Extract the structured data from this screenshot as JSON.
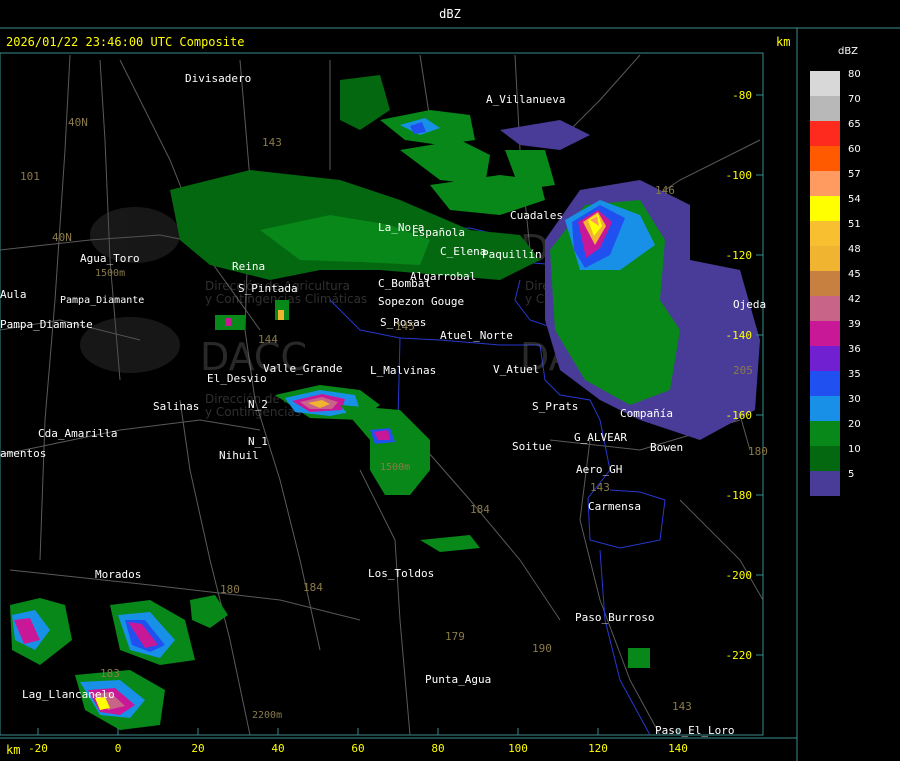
{
  "header": {
    "title": "dBZ"
  },
  "timestamp": "2026/01/22 23:46:00 UTC Composite",
  "unit_top": "km",
  "unit_bottom": "km",
  "axes": {
    "x_ticks": [
      "-20",
      "0",
      "20",
      "40",
      "60",
      "80",
      "100",
      "120",
      "140"
    ],
    "y_ticks": [
      "-80",
      "-100",
      "-120",
      "-140",
      "-160",
      "-180",
      "-200",
      "-220"
    ]
  },
  "legend": {
    "title": "dBZ",
    "entries": [
      {
        "label": "80",
        "color": "#d8d8d8"
      },
      {
        "label": "70",
        "color": "#b8b8b8"
      },
      {
        "label": "65",
        "color": "#ff2a1e"
      },
      {
        "label": "60",
        "color": "#ff5a00"
      },
      {
        "label": "57",
        "color": "#ff9a60"
      },
      {
        "label": "54",
        "color": "#ffff00"
      },
      {
        "label": "51",
        "color": "#f8c030"
      },
      {
        "label": "48",
        "color": "#f0b430"
      },
      {
        "label": "45",
        "color": "#c88040"
      },
      {
        "label": "42",
        "color": "#c86488"
      },
      {
        "label": "39",
        "color": "#c81898"
      },
      {
        "label": "36",
        "color": "#7020d0"
      },
      {
        "label": "35",
        "color": "#2050f0"
      },
      {
        "label": "30",
        "color": "#1890e8"
      },
      {
        "label": "20",
        "color": "#088818"
      },
      {
        "label": "10",
        "color": "#046810"
      },
      {
        "label": "5",
        "color": "#483c98"
      }
    ]
  },
  "places": [
    "Divisadero",
    "A_Villanueva",
    "Cuadales",
    "Agua_Toro",
    "Aula",
    "Pampa_Diamante",
    "Pampa_Diamante",
    "La_Nora",
    "Española",
    "C_Elena",
    "Paquillín",
    "Algarrobal",
    "C_Bombal",
    "Sopezon Gouge",
    "S_Rosas",
    "Atuel_Norte",
    "S_Pintada",
    "Reina",
    "L_Malvinas",
    "V_Atuel",
    "El_Desvio",
    "Valle_Grande",
    "Salinas",
    "N_2",
    "N_1",
    "Nihuil",
    "Cda_Amarilla",
    "amentos",
    "S_Prats",
    "Soitue",
    "G_ALVEAR",
    "Compañía",
    "Bowen",
    "Aero_GH",
    "Carmensa",
    "Morados",
    "Los_Toldos",
    "Paso_Burroso",
    "Punta_Agua",
    "Lag_Llancanelo",
    "Paso_El_Loro",
    "Ojeda"
  ],
  "route_numbers": [
    "40N",
    "101",
    "40N",
    "143",
    "146",
    "144",
    "143",
    "145",
    "184",
    "180",
    "184",
    "179",
    "190",
    "183",
    "143",
    "205",
    "180"
  ],
  "elevations": [
    "1500m",
    "2200m",
    "1500m"
  ],
  "watermark": {
    "brand": "DACC",
    "line1": "Dirección de Agricultura",
    "line2": "y Contingencias Climáticas"
  }
}
